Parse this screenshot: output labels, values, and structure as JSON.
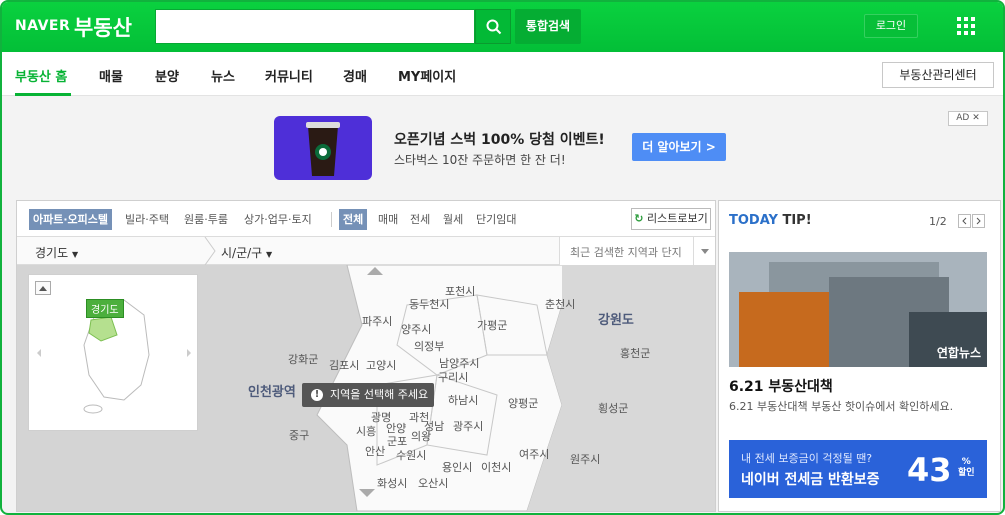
{
  "header": {
    "logo_naver": "NAVER",
    "logo_service": "부동산",
    "search_placeholder": "",
    "search_button_label": "통합검색",
    "login_label": "로그인"
  },
  "nav": {
    "items": [
      "부동산 홈",
      "매물",
      "분양",
      "뉴스",
      "커뮤니티",
      "경매",
      "MY페이지"
    ],
    "manager_button": "부동산관리센터"
  },
  "ad": {
    "title": "오픈기념 스벅 100% 당첨 이벤트!",
    "subtitle": "스타벅스 10잔 주문하면 한 잔 더!",
    "button": "더 알아보기 >",
    "badge": "AD ✕"
  },
  "filters": {
    "property_types": [
      "아파트·오피스텔",
      "빌라·주택",
      "원룸·투룸",
      "상가·업무·토지"
    ],
    "trade_types": [
      "전체",
      "매매",
      "전세",
      "월세",
      "단기임대"
    ],
    "list_button": "리스트로보기"
  },
  "region": {
    "province": "경기도",
    "district": "시/군/구",
    "recent_label": "최근 검색한 지역과 단지"
  },
  "map": {
    "mini_tag": "경기도",
    "tooltip": "지역을 선택해 주세요",
    "labels": [
      {
        "text": "포천시"
      },
      {
        "text": "동두천시"
      },
      {
        "text": "파주시"
      },
      {
        "text": "양주시"
      },
      {
        "text": "가평군"
      },
      {
        "text": "의정부"
      },
      {
        "text": "강화군"
      },
      {
        "text": "김포시"
      },
      {
        "text": "고양시"
      },
      {
        "text": "남양주시"
      },
      {
        "text": "구리시"
      },
      {
        "text": "하남시"
      },
      {
        "text": "양평군"
      },
      {
        "text": "광명"
      },
      {
        "text": "과천"
      },
      {
        "text": "시흥"
      },
      {
        "text": "안양"
      },
      {
        "text": "군포"
      },
      {
        "text": "의왕"
      },
      {
        "text": "성남"
      },
      {
        "text": "광주시"
      },
      {
        "text": "안산"
      },
      {
        "text": "수원시"
      },
      {
        "text": "여주시"
      },
      {
        "text": "용인시"
      },
      {
        "text": "이천시"
      },
      {
        "text": "화성시"
      },
      {
        "text": "오산시"
      },
      {
        "text": "춘천시"
      },
      {
        "text": "홍천군"
      },
      {
        "text": "횡성군"
      },
      {
        "text": "원주시"
      },
      {
        "text": "중구"
      }
    ],
    "big_labels": [
      {
        "text": "인천광역"
      },
      {
        "text": "강원도"
      }
    ]
  },
  "tip": {
    "head_1": "TODAY",
    "head_2": " TIP!",
    "page": "1/2",
    "news_logo": "연합뉴스",
    "news_title": "6.21 부동산대책",
    "news_desc": "6.21 부동산대책 부동산 핫이슈에서 확인하세요.",
    "banner_line1": "내 전세 보증금이 걱정될 땐?",
    "banner_line2": "네이버 전세금 반환보증",
    "banner_percent": "43",
    "banner_unit": "%",
    "banner_discount": "할인"
  }
}
